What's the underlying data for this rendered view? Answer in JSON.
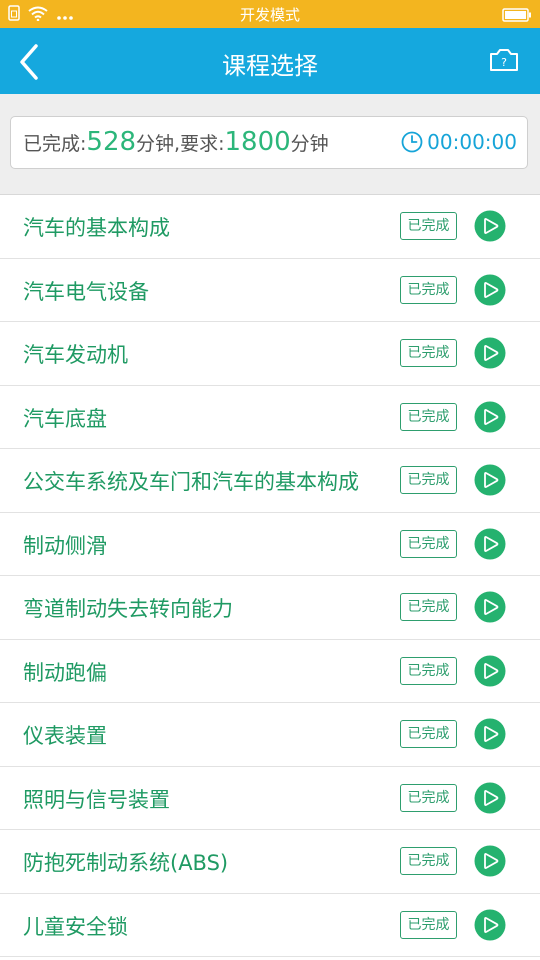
{
  "status_bar": {
    "title": "开发模式",
    "icons": [
      "sim-icon",
      "wifi-icon",
      "more-dots-icon",
      "battery-icon"
    ]
  },
  "nav": {
    "title": "课程选择",
    "icons": [
      "back-arrow-icon",
      "camera-help-icon"
    ]
  },
  "summary": {
    "completed_label": "已完成:",
    "completed_value": "528",
    "unit1": "分钟,",
    "required_label": "要求:",
    "required_value": "1800",
    "unit2": "分钟",
    "timer": "00:00:00"
  },
  "courses": [
    {
      "name": "汽车的基本构成",
      "status": "已完成"
    },
    {
      "name": "汽车电气设备",
      "status": "已完成"
    },
    {
      "name": "汽车发动机",
      "status": "已完成"
    },
    {
      "name": "汽车底盘",
      "status": "已完成"
    },
    {
      "name": "公交车系统及车门和汽车的基本构成",
      "status": "已完成"
    },
    {
      "name": "制动侧滑",
      "status": "已完成"
    },
    {
      "name": "弯道制动失去转向能力",
      "status": "已完成"
    },
    {
      "name": "制动跑偏",
      "status": "已完成"
    },
    {
      "name": "仪表装置",
      "status": "已完成"
    },
    {
      "name": "照明与信号装置",
      "status": "已完成"
    },
    {
      "name": "防抱死制动系统(ABS)",
      "status": "已完成"
    },
    {
      "name": "儿童安全锁",
      "status": "已完成"
    }
  ],
  "colors": {
    "status_bar": "#f3b51f",
    "nav": "#15a8de",
    "accent_green": "#1f9a63",
    "timer_blue": "#16a4d8"
  }
}
